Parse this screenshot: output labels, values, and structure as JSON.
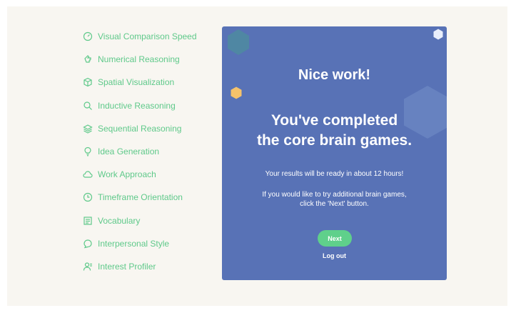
{
  "sidebar": {
    "items": [
      {
        "label": "Visual Comparison Speed"
      },
      {
        "label": "Numerical Reasoning"
      },
      {
        "label": "Spatial Visualization"
      },
      {
        "label": "Inductive Reasoning"
      },
      {
        "label": "Sequential Reasoning"
      },
      {
        "label": "Idea Generation"
      },
      {
        "label": "Work Approach"
      },
      {
        "label": "Timeframe Orientation"
      },
      {
        "label": "Vocabulary"
      },
      {
        "label": "Interpersonal Style"
      },
      {
        "label": "Interest Profiler"
      }
    ]
  },
  "card": {
    "heading": "Nice work!",
    "subheading_line1": "You've completed",
    "subheading_line2": "the core brain games.",
    "results_text": "Your results will be ready in about 12 hours!",
    "additional_line1": "If you would like to try additional brain games,",
    "additional_line2": "click the 'Next' button.",
    "next_label": "Next",
    "logout_label": "Log out"
  },
  "colors": {
    "accent_green": "#5fc98a",
    "card_blue": "#5872b6",
    "button_green": "#5fd08b",
    "page_background": "#f8f6f1"
  }
}
